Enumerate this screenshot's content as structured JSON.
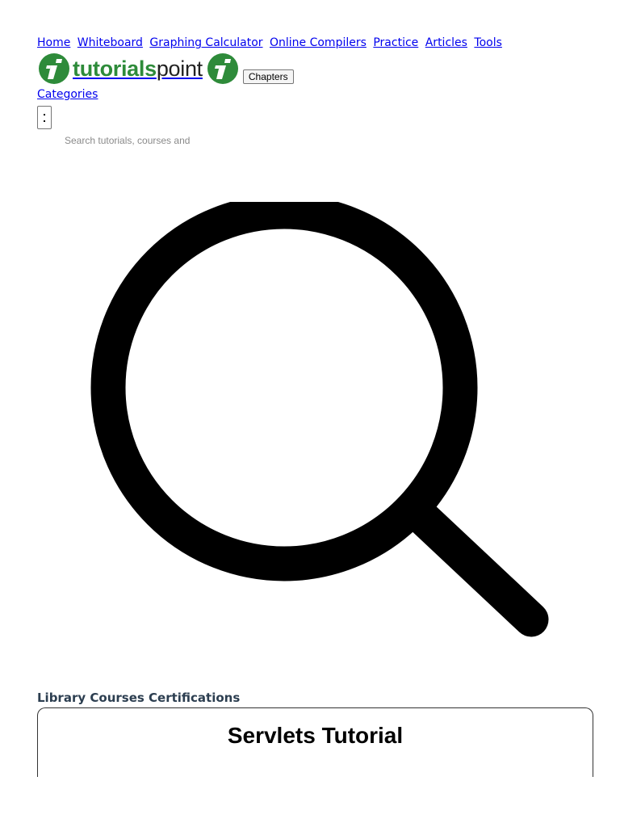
{
  "nav": {
    "items": [
      "Home",
      "Whiteboard",
      "Graphing Calculator",
      "Online Compilers",
      "Practice",
      "Articles",
      "Tools"
    ]
  },
  "logo": {
    "text_bold": "tutorials",
    "text_light": "point"
  },
  "chapters_label": "Chapters",
  "categories_label": "Categories",
  "search": {
    "placeholder": "Search tutorials, courses and"
  },
  "tabs": {
    "library": "Library",
    "courses": "Courses",
    "certifications": "Certifications"
  },
  "page": {
    "title": "Servlets Tutorial"
  },
  "colors": {
    "brand_green": "#2e8b3a",
    "link": "#0000ee",
    "tabs_text": "#2c3e50"
  }
}
